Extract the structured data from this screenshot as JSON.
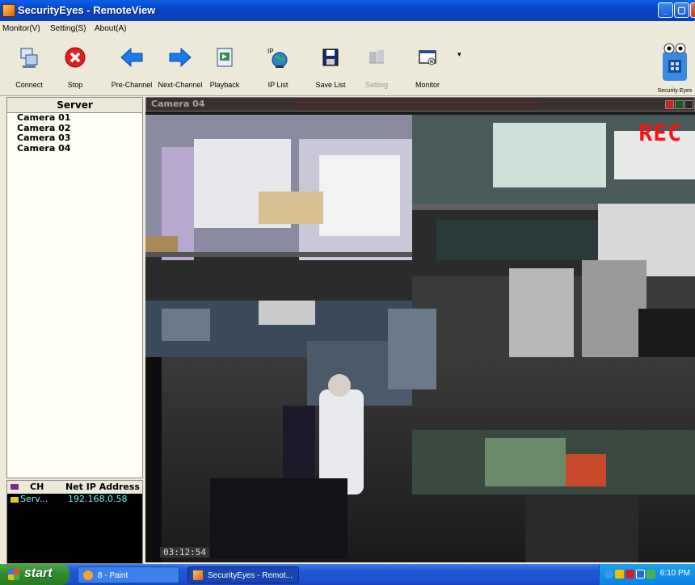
{
  "window": {
    "title": "SecurityEyes - RemoteView",
    "min": "_",
    "max": "▢",
    "close": "✕"
  },
  "menu": [
    "Monitor(V)",
    "Setting(S)",
    "About(A)"
  ],
  "toolbar": {
    "connect": "Connect",
    "stop": "Stop",
    "pre_channel": "Pre-Channel",
    "next_channel": "Next-Channel",
    "playback": "Playback",
    "ip_list": "IP List",
    "save_list": "Save List",
    "setting": "Setting",
    "monitor": "Monitor",
    "brand_label": "Security Eyes"
  },
  "server_panel": {
    "header": "Server",
    "cameras": [
      "Camera 01",
      "Camera 02",
      "Camera 03",
      "Camera 04"
    ]
  },
  "connections": {
    "col_ch": "CH",
    "col_ip": "Net IP Address",
    "rows": [
      {
        "server": "Serv...",
        "ip": "192.168.0.58"
      }
    ]
  },
  "viewer": {
    "title": "Camera 04",
    "rec": "REC",
    "timecode": "03:12:54"
  },
  "taskbar": {
    "start": "start",
    "tasks": [
      "8 - Paint",
      "SecurityEyes - Remot..."
    ],
    "clock": "6:10 PM"
  },
  "colors": {
    "rec": "#ff1010",
    "title_blue": "#0842c4",
    "start_green": "#2f8a2c"
  }
}
